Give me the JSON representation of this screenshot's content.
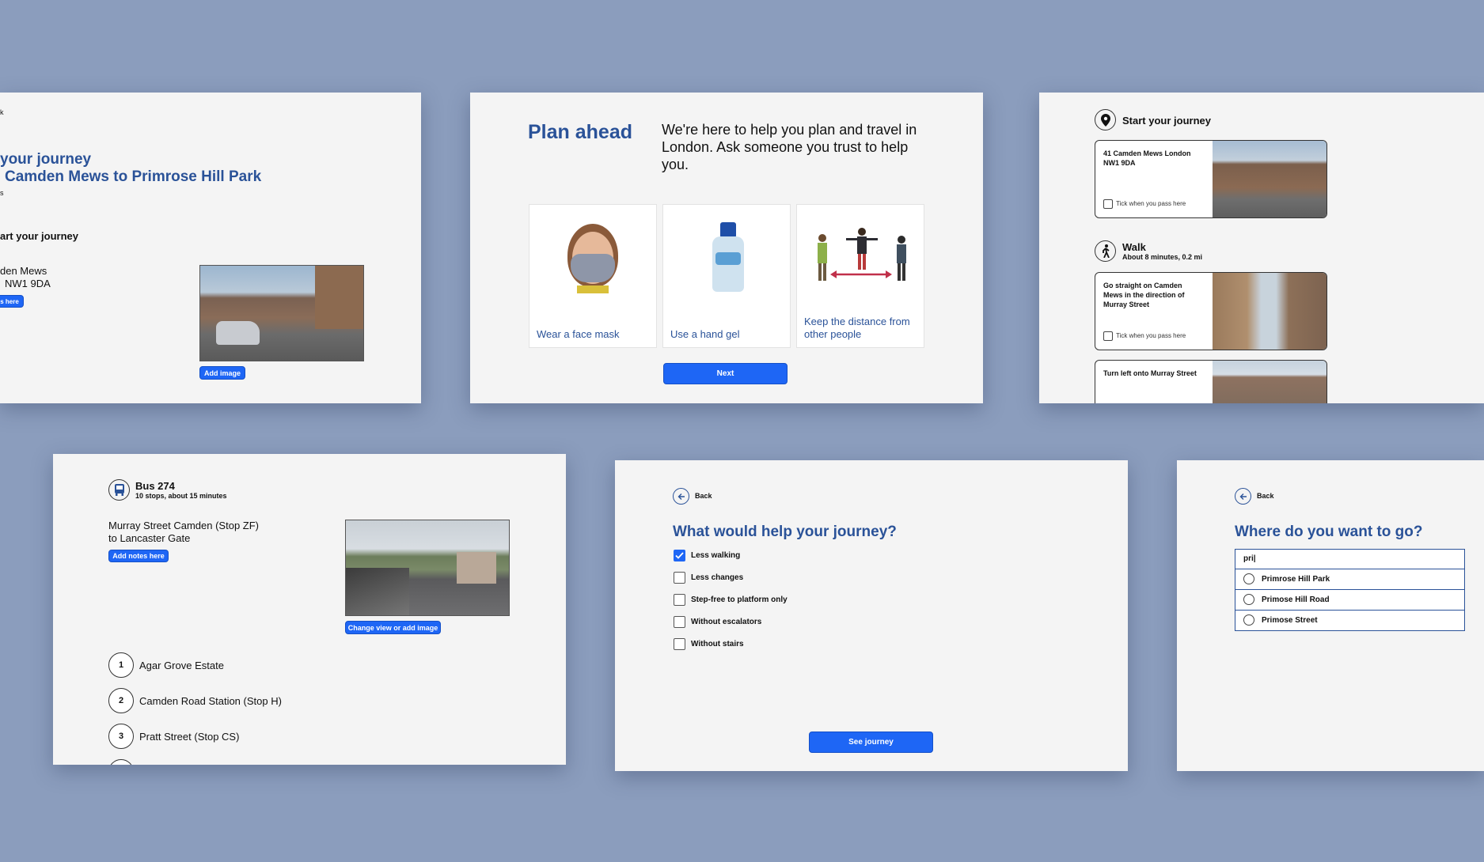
{
  "card1": {
    "back_fragment": "k",
    "heading_line1": "your journey",
    "heading_line2": "Camden Mews to Primrose Hill Park",
    "sub_fragment": "s",
    "section": "art your journey",
    "addr_line1": "den Mews",
    "addr_line2": "NW1 9DA",
    "notes_btn": "s here",
    "add_image_btn": "Add image"
  },
  "card2": {
    "title": "Plan ahead",
    "intro": "We're here to help you plan and travel in London. Ask someone you trust to help you.",
    "tips": [
      {
        "label": "Wear a face mask"
      },
      {
        "label": "Use a hand gel"
      },
      {
        "label": "Keep the distance from other people"
      }
    ],
    "next_btn": "Next"
  },
  "card3": {
    "start_title": "Start your journey",
    "address": "41 Camden Mews London NW1 9DA",
    "tick_label": "Tick when you pass here",
    "walk_title": "Walk",
    "walk_sub": "About 8 minutes, 0.2 mi",
    "step1": "Go straight on Camden Mews in the direction of Murray Street",
    "step2": "Turn left onto Murray Street"
  },
  "card4": {
    "bus_title": "Bus 274",
    "bus_sub": "10 stops, about 15 minutes",
    "route_line1": "Murray Street Camden (Stop ZF)",
    "route_line2": "to Lancaster Gate",
    "notes_btn": "Add notes here",
    "change_btn": "Change view or add image",
    "stops": [
      {
        "num": "1",
        "name": "Agar Grove Estate"
      },
      {
        "num": "2",
        "name": "Camden Road Station (Stop H)"
      },
      {
        "num": "3",
        "name": "Pratt Street (Stop CS)"
      }
    ]
  },
  "card5": {
    "back": "Back",
    "title": "What would help your journey?",
    "options": [
      {
        "label": "Less walking",
        "checked": true
      },
      {
        "label": "Less changes",
        "checked": false
      },
      {
        "label": "Step-free to platform only",
        "checked": false
      },
      {
        "label": "Without escalators",
        "checked": false
      },
      {
        "label": "Without stairs",
        "checked": false
      }
    ],
    "see_btn": "See journey"
  },
  "card6": {
    "back": "Back",
    "title": "Where do you want to go?",
    "search_value": "pri|",
    "results": [
      "Primrose Hill Park",
      "Primose Hill Road",
      "Primose Street"
    ]
  },
  "colors": {
    "background": "#8b9dbd",
    "accent": "#1e66f5",
    "heading": "#2a5298",
    "card": "#f4f4f4"
  }
}
